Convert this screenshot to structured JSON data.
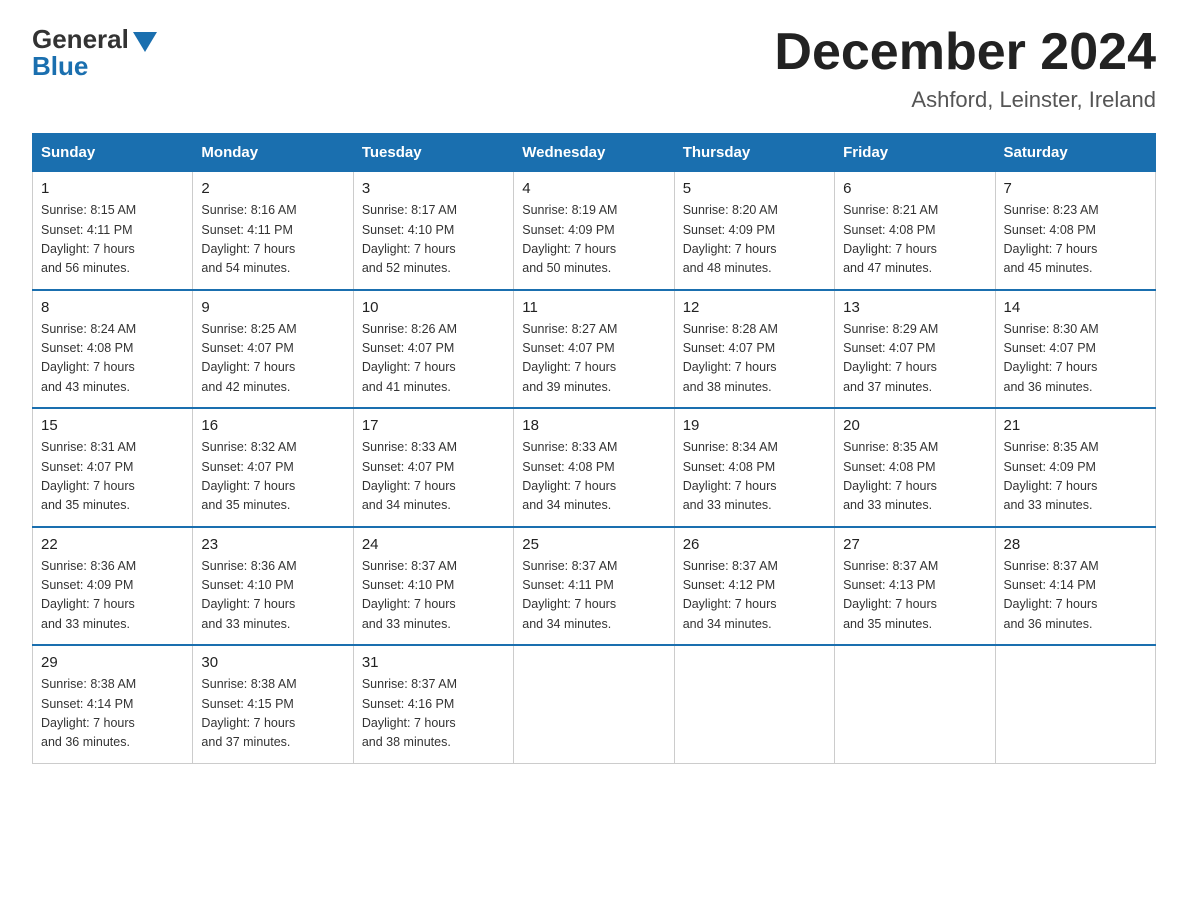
{
  "header": {
    "logo_general": "General",
    "logo_blue": "Blue",
    "month_title": "December 2024",
    "location": "Ashford, Leinster, Ireland"
  },
  "weekdays": [
    "Sunday",
    "Monday",
    "Tuesday",
    "Wednesday",
    "Thursday",
    "Friday",
    "Saturday"
  ],
  "weeks": [
    [
      {
        "day": "1",
        "sunrise": "8:15 AM",
        "sunset": "4:11 PM",
        "daylight": "7 hours and 56 minutes."
      },
      {
        "day": "2",
        "sunrise": "8:16 AM",
        "sunset": "4:11 PM",
        "daylight": "7 hours and 54 minutes."
      },
      {
        "day": "3",
        "sunrise": "8:17 AM",
        "sunset": "4:10 PM",
        "daylight": "7 hours and 52 minutes."
      },
      {
        "day": "4",
        "sunrise": "8:19 AM",
        "sunset": "4:09 PM",
        "daylight": "7 hours and 50 minutes."
      },
      {
        "day": "5",
        "sunrise": "8:20 AM",
        "sunset": "4:09 PM",
        "daylight": "7 hours and 48 minutes."
      },
      {
        "day": "6",
        "sunrise": "8:21 AM",
        "sunset": "4:08 PM",
        "daylight": "7 hours and 47 minutes."
      },
      {
        "day": "7",
        "sunrise": "8:23 AM",
        "sunset": "4:08 PM",
        "daylight": "7 hours and 45 minutes."
      }
    ],
    [
      {
        "day": "8",
        "sunrise": "8:24 AM",
        "sunset": "4:08 PM",
        "daylight": "7 hours and 43 minutes."
      },
      {
        "day": "9",
        "sunrise": "8:25 AM",
        "sunset": "4:07 PM",
        "daylight": "7 hours and 42 minutes."
      },
      {
        "day": "10",
        "sunrise": "8:26 AM",
        "sunset": "4:07 PM",
        "daylight": "7 hours and 41 minutes."
      },
      {
        "day": "11",
        "sunrise": "8:27 AM",
        "sunset": "4:07 PM",
        "daylight": "7 hours and 39 minutes."
      },
      {
        "day": "12",
        "sunrise": "8:28 AM",
        "sunset": "4:07 PM",
        "daylight": "7 hours and 38 minutes."
      },
      {
        "day": "13",
        "sunrise": "8:29 AM",
        "sunset": "4:07 PM",
        "daylight": "7 hours and 37 minutes."
      },
      {
        "day": "14",
        "sunrise": "8:30 AM",
        "sunset": "4:07 PM",
        "daylight": "7 hours and 36 minutes."
      }
    ],
    [
      {
        "day": "15",
        "sunrise": "8:31 AM",
        "sunset": "4:07 PM",
        "daylight": "7 hours and 35 minutes."
      },
      {
        "day": "16",
        "sunrise": "8:32 AM",
        "sunset": "4:07 PM",
        "daylight": "7 hours and 35 minutes."
      },
      {
        "day": "17",
        "sunrise": "8:33 AM",
        "sunset": "4:07 PM",
        "daylight": "7 hours and 34 minutes."
      },
      {
        "day": "18",
        "sunrise": "8:33 AM",
        "sunset": "4:08 PM",
        "daylight": "7 hours and 34 minutes."
      },
      {
        "day": "19",
        "sunrise": "8:34 AM",
        "sunset": "4:08 PM",
        "daylight": "7 hours and 33 minutes."
      },
      {
        "day": "20",
        "sunrise": "8:35 AM",
        "sunset": "4:08 PM",
        "daylight": "7 hours and 33 minutes."
      },
      {
        "day": "21",
        "sunrise": "8:35 AM",
        "sunset": "4:09 PM",
        "daylight": "7 hours and 33 minutes."
      }
    ],
    [
      {
        "day": "22",
        "sunrise": "8:36 AM",
        "sunset": "4:09 PM",
        "daylight": "7 hours and 33 minutes."
      },
      {
        "day": "23",
        "sunrise": "8:36 AM",
        "sunset": "4:10 PM",
        "daylight": "7 hours and 33 minutes."
      },
      {
        "day": "24",
        "sunrise": "8:37 AM",
        "sunset": "4:10 PM",
        "daylight": "7 hours and 33 minutes."
      },
      {
        "day": "25",
        "sunrise": "8:37 AM",
        "sunset": "4:11 PM",
        "daylight": "7 hours and 34 minutes."
      },
      {
        "day": "26",
        "sunrise": "8:37 AM",
        "sunset": "4:12 PM",
        "daylight": "7 hours and 34 minutes."
      },
      {
        "day": "27",
        "sunrise": "8:37 AM",
        "sunset": "4:13 PM",
        "daylight": "7 hours and 35 minutes."
      },
      {
        "day": "28",
        "sunrise": "8:37 AM",
        "sunset": "4:14 PM",
        "daylight": "7 hours and 36 minutes."
      }
    ],
    [
      {
        "day": "29",
        "sunrise": "8:38 AM",
        "sunset": "4:14 PM",
        "daylight": "7 hours and 36 minutes."
      },
      {
        "day": "30",
        "sunrise": "8:38 AM",
        "sunset": "4:15 PM",
        "daylight": "7 hours and 37 minutes."
      },
      {
        "day": "31",
        "sunrise": "8:37 AM",
        "sunset": "4:16 PM",
        "daylight": "7 hours and 38 minutes."
      },
      null,
      null,
      null,
      null
    ]
  ],
  "labels": {
    "sunrise": "Sunrise:",
    "sunset": "Sunset:",
    "daylight": "Daylight:"
  }
}
